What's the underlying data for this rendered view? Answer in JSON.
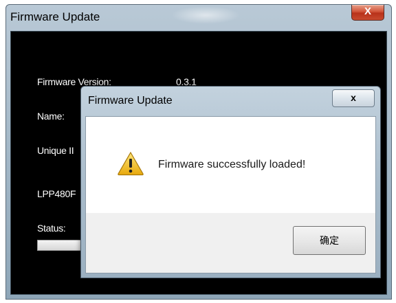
{
  "main_window": {
    "title": "Firmware Update",
    "close_glyph": "X",
    "labels": {
      "firmware_version": "Firmware Version:",
      "firmware_version_value": "0.3.1",
      "name": "Name:",
      "unique_id": "Unique II",
      "device": "LPP480F",
      "status": "Status:"
    }
  },
  "dialog": {
    "title": "Firmware Update",
    "close_glyph": "x",
    "icon": "warning-icon",
    "message": "Firmware successfully loaded!",
    "ok_label": "确定"
  },
  "colors": {
    "warning_yellow": "#f2c21b",
    "close_red": "#c8432a"
  }
}
